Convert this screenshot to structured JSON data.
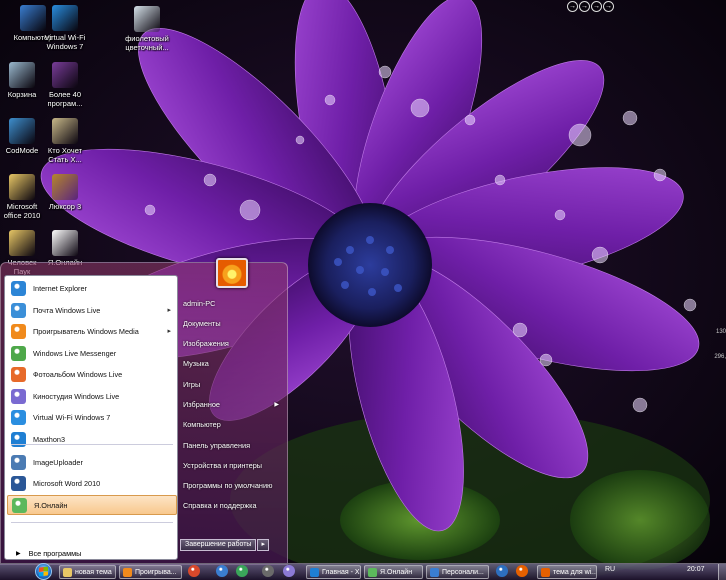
{
  "desktop": {
    "icons": [
      {
        "label": "Компьютер",
        "label2": "",
        "icon": "computer-icon",
        "color": "#3a7ed1"
      },
      {
        "label": "Virtual Wi-Fi",
        "label2": "Windows 7",
        "icon": "wifi-icon",
        "color": "#2a8ee0"
      },
      {
        "label": "фиолетовый",
        "label2": "цветочный...",
        "icon": "image-file-icon",
        "color": "#d6e2ea"
      },
      {
        "label": "Корзина",
        "label2": "",
        "icon": "recycle-bin-icon",
        "color": "#9bb9cf"
      },
      {
        "label": "Более 40",
        "label2": "програм...",
        "icon": "winrar-icon",
        "color": "#7a3d9a"
      },
      {
        "label": "CodMode",
        "label2": "",
        "icon": "codmode-icon",
        "color": "#3e8fce"
      },
      {
        "label": "Кто Хочет",
        "label2": "Стать Х...",
        "icon": "skull-icon",
        "color": "#c9b98a"
      },
      {
        "label": "Microsoft",
        "label2": "office 2010",
        "icon": "folder-icon",
        "color": "#e8c766"
      },
      {
        "label": "Люксор 3",
        "label2": "",
        "icon": "luxor-icon",
        "color": "#b5882d"
      },
      {
        "label": "Человек",
        "label2": "Паук",
        "icon": "folder-icon",
        "color": "#e8c766"
      },
      {
        "label": "Я.Онлайн",
        "label2": "",
        "icon": "ya-online-icon",
        "color": "#ffffff"
      }
    ],
    "corner_buttons": [
      "→",
      "→",
      "→",
      "→"
    ],
    "side_numbers": [
      "130",
      "296,"
    ]
  },
  "start_menu": {
    "programs": [
      {
        "label": "Internet Explorer",
        "icon": "internet-explorer-icon",
        "color": "#2c85d6",
        "has_arrow": false
      },
      {
        "label": "Почта Windows Live",
        "icon": "mail-icon",
        "color": "#3b8fd8",
        "has_arrow": true
      },
      {
        "label": "Проигрыватель Windows Media",
        "icon": "media-player-icon",
        "color": "#f08a1c",
        "has_arrow": true
      },
      {
        "label": "Windows Live Messenger",
        "icon": "messenger-icon",
        "color": "#4ea84a",
        "has_arrow": false
      },
      {
        "label": "Фотоальбом Windows Live",
        "icon": "photo-gallery-icon",
        "color": "#e76a2a",
        "has_arrow": false
      },
      {
        "label": "Киностудия Windows Live",
        "icon": "movie-maker-icon",
        "color": "#7a6ad1",
        "has_arrow": false
      },
      {
        "label": "Virtual Wi-Fi Windows 7",
        "icon": "wifi-icon",
        "color": "#2a8ee0",
        "has_arrow": false
      },
      {
        "label": "Maxthon3",
        "icon": "maxthon-icon",
        "color": "#1f7fd3",
        "has_arrow": false
      },
      {
        "label": "ImageUploader",
        "icon": "uploader-icon",
        "color": "#4b7bb3",
        "has_arrow": false
      },
      {
        "label": "Microsoft Word 2010",
        "icon": "word-icon",
        "color": "#2b5797",
        "has_arrow": false
      },
      {
        "label": "Я.Онлайн",
        "icon": "ya-online-icon",
        "color": "#5cb85c",
        "has_arrow": false
      }
    ],
    "highlighted_index": 10,
    "all_programs": "Все программы",
    "right_items": [
      {
        "label": "admin-PC",
        "has_arrow": false
      },
      {
        "label": "Документы",
        "has_arrow": false
      },
      {
        "label": "Изображения",
        "has_arrow": false
      },
      {
        "label": "Музыка",
        "has_arrow": false
      },
      {
        "label": "Игры",
        "has_arrow": false
      },
      {
        "label": "Избранное",
        "has_arrow": true
      },
      {
        "label": "Компьютер",
        "has_arrow": false
      },
      {
        "label": "Панель управления",
        "has_arrow": false
      },
      {
        "label": "Устройства и принтеры",
        "has_arrow": false
      },
      {
        "label": "Программы по умолчанию",
        "has_arrow": false
      },
      {
        "label": "Справка и поддержка",
        "has_arrow": false
      }
    ],
    "shutdown_label": "Завершение работы",
    "shutdown_arrow": "▸"
  },
  "taskbar": {
    "buttons": [
      {
        "label": "новая тема",
        "icon": "folder-icon",
        "color": "#e8c766"
      },
      {
        "label": "Проигрыва...",
        "icon": "media-player-icon",
        "color": "#f08a1c"
      },
      {
        "label": "Главная - Х...",
        "icon": "maxthon-icon",
        "color": "#1f7fd3"
      },
      {
        "label": "Я.Онлайн",
        "icon": "ya-online-icon",
        "color": "#5cb85c"
      },
      {
        "label": "Персонали...",
        "icon": "personalize-icon",
        "color": "#3a7ed1"
      },
      {
        "label": "тема для wi...",
        "icon": "firefox-icon",
        "color": "#e66000"
      }
    ],
    "language": "RU",
    "clock": "20:07"
  }
}
